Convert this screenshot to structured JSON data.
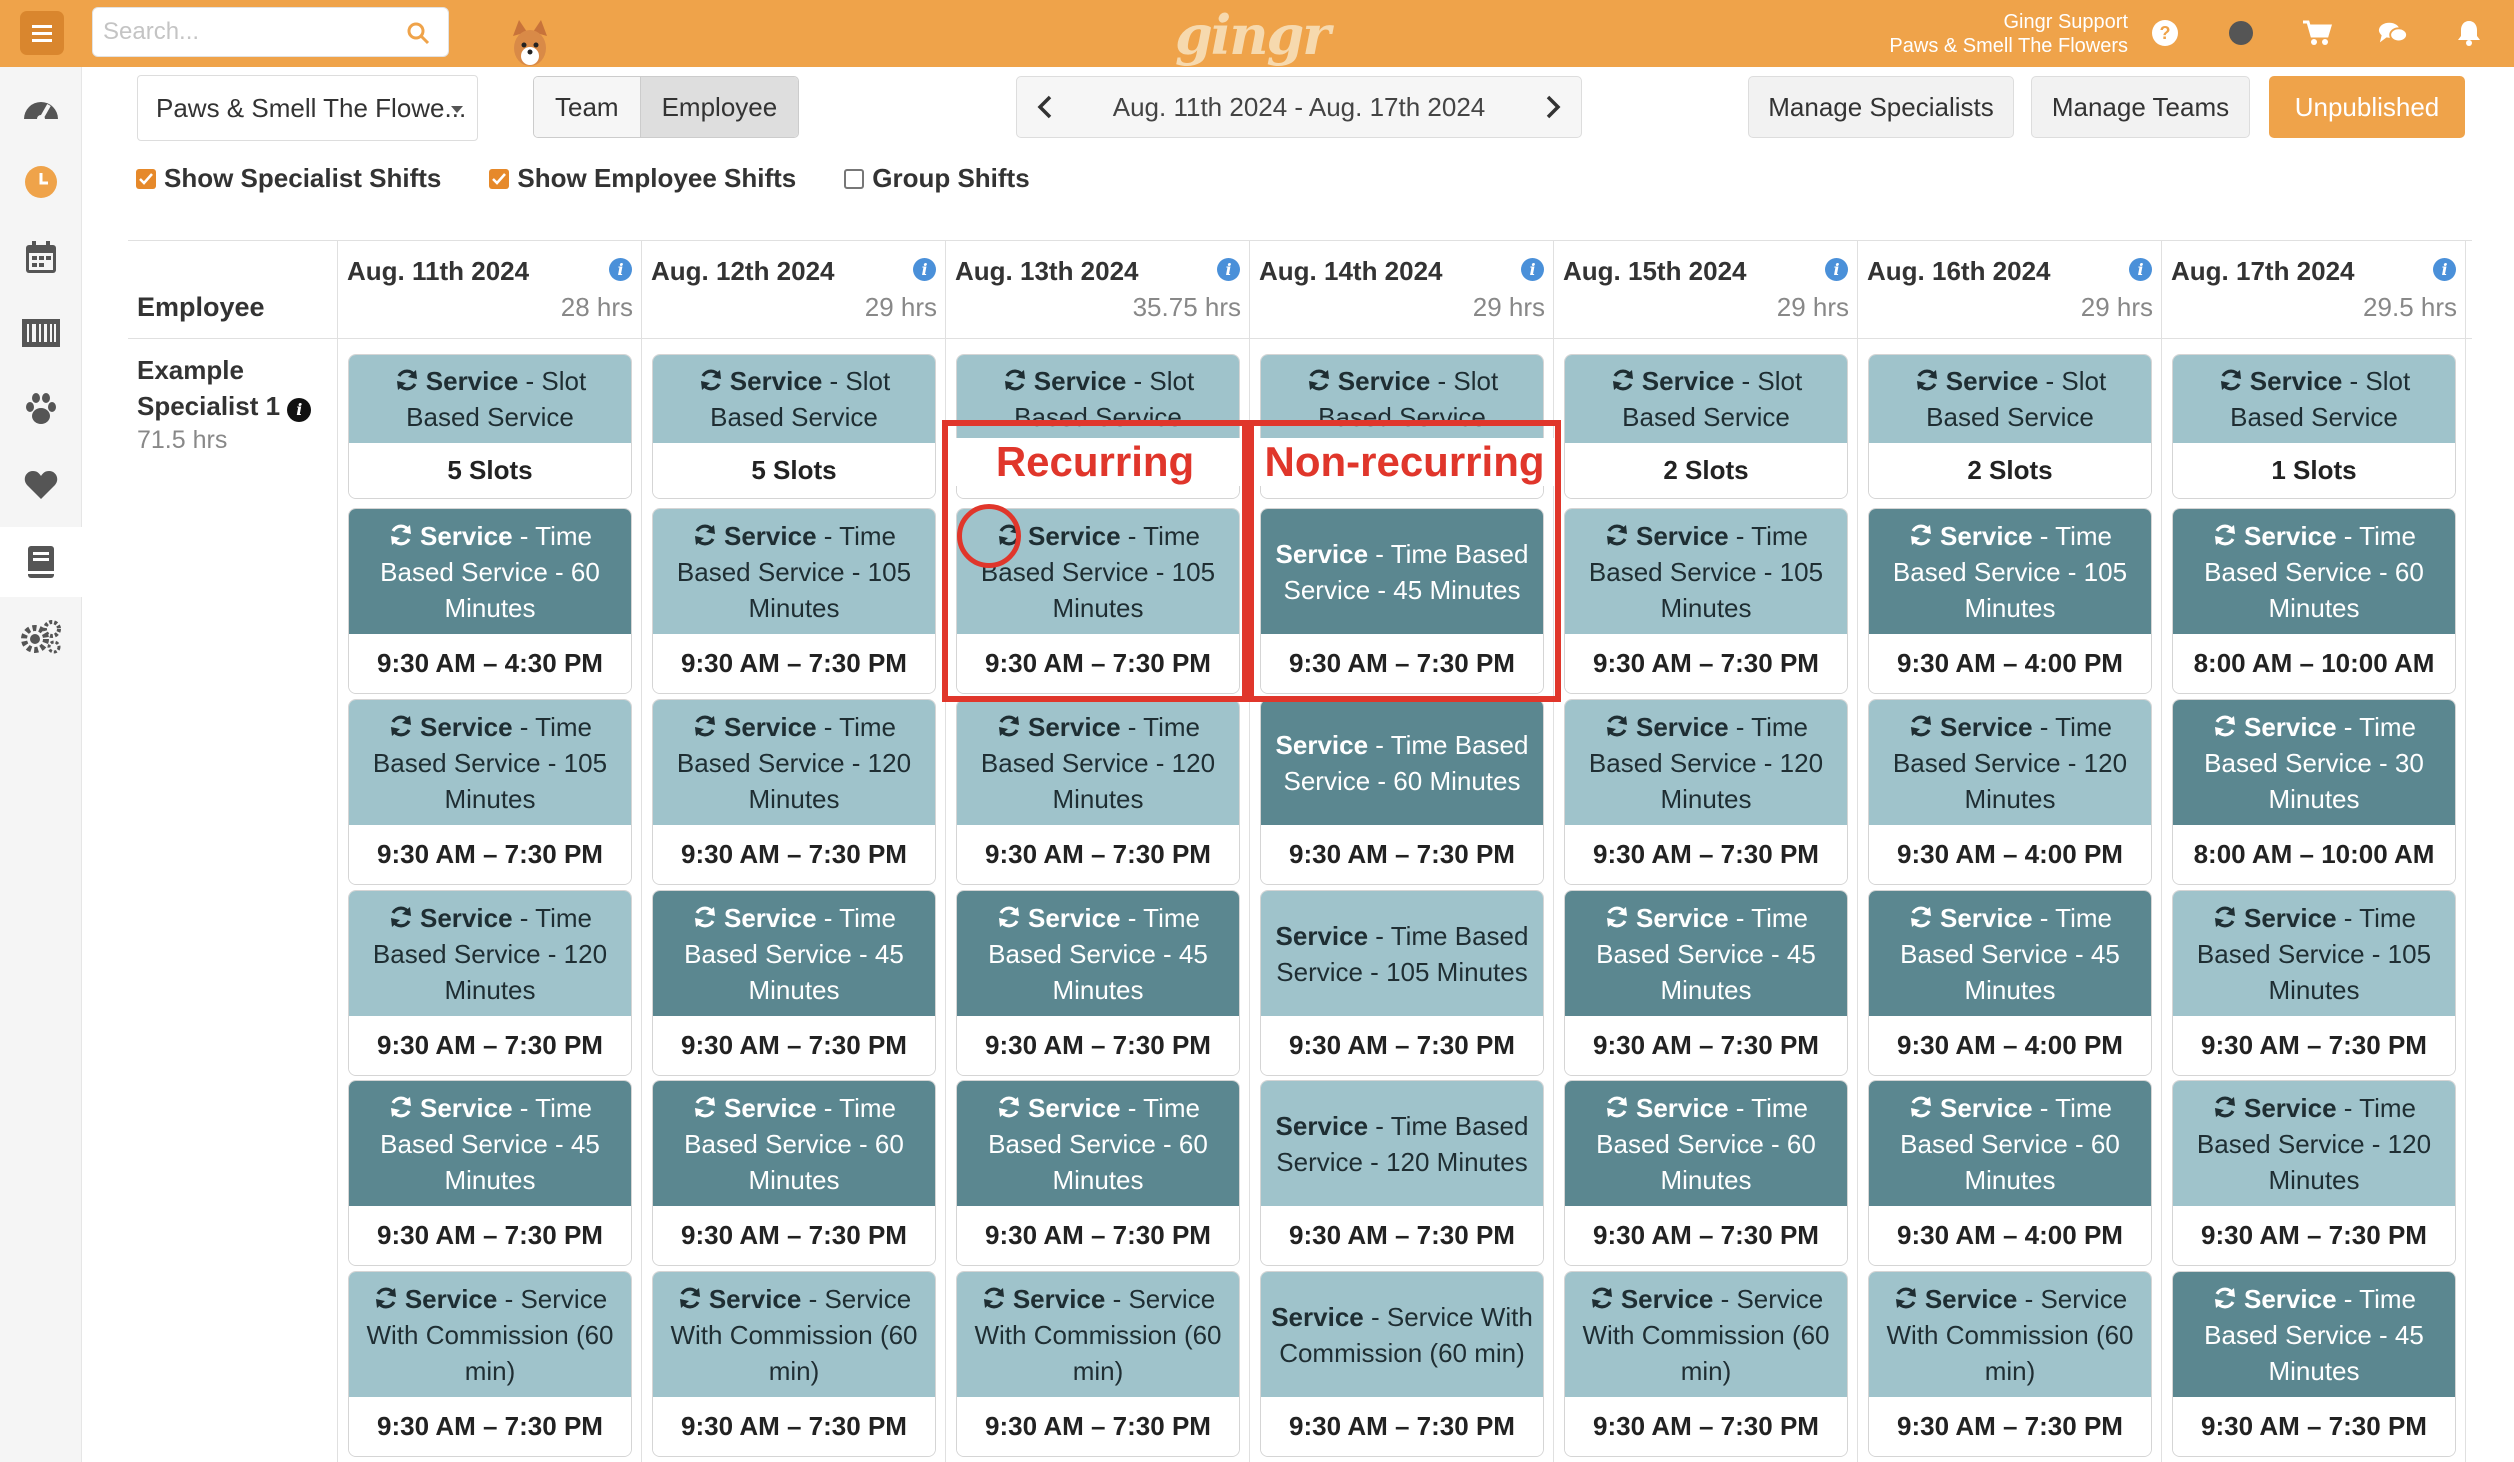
{
  "topbar": {
    "search_placeholder": "Search...",
    "logo": "gingr",
    "support_line1": "Gingr Support",
    "support_line2": "Paws & Smell The Flowers",
    "icons": [
      "help-icon",
      "status-dot-icon",
      "cart-icon",
      "chat-icon",
      "bell-icon"
    ]
  },
  "sidebar": {
    "items": [
      "dashboard-icon",
      "clock-icon",
      "calendar-icon",
      "barcode-icon",
      "paw-icon",
      "heart-icon",
      "book-icon",
      "settings-icon"
    ],
    "active": "book-icon"
  },
  "toolbar": {
    "location": "Paws & Smell The Flowe...",
    "view_team": "Team",
    "view_employee": "Employee",
    "date_range": "Aug. 11th 2024 - Aug. 17th 2024",
    "manage_specialists": "Manage Specialists",
    "manage_teams": "Manage Teams",
    "unpublished": "Unpublished"
  },
  "filters": {
    "show_specialist": "Show Specialist Shifts",
    "show_employee": "Show Employee Shifts",
    "group_shifts": "Group Shifts"
  },
  "table": {
    "employee_header": "Employee",
    "employee_name_1": "Example",
    "employee_name_2": "Specialist 1",
    "employee_hours": "71.5 hrs",
    "days": [
      {
        "date": "Aug. 11th 2024",
        "hours": "28 hrs"
      },
      {
        "date": "Aug. 12th 2024",
        "hours": "29 hrs"
      },
      {
        "date": "Aug. 13th 2024",
        "hours": "35.75 hrs"
      },
      {
        "date": "Aug. 14th 2024",
        "hours": "29 hrs"
      },
      {
        "date": "Aug. 15th 2024",
        "hours": "29 hrs"
      },
      {
        "date": "Aug. 16th 2024",
        "hours": "29 hrs"
      },
      {
        "date": "Aug. 17th 2024",
        "hours": "29.5 hrs"
      }
    ],
    "service_word": "Service",
    "columns": [
      [
        {
          "sub": "Slot Based Service",
          "time": "5 Slots",
          "dark": false,
          "rec": true
        },
        {
          "sub": "Time Based Service - 60 Minutes",
          "time": "9:30 AM – 4:30 PM",
          "dark": true,
          "rec": true
        },
        {
          "sub": "Time Based Service - 105 Minutes",
          "time": "9:30 AM – 7:30 PM",
          "dark": false,
          "rec": true
        },
        {
          "sub": "Time Based Service - 120 Minutes",
          "time": "9:30 AM – 7:30 PM",
          "dark": false,
          "rec": true
        },
        {
          "sub": "Time Based Service - 45 Minutes",
          "time": "9:30 AM – 7:30 PM",
          "dark": true,
          "rec": true
        },
        {
          "sub": "Service With Commission (60 min)",
          "time": "9:30 AM – 7:30 PM",
          "dark": false,
          "rec": true
        }
      ],
      [
        {
          "sub": "Slot Based Service",
          "time": "5 Slots",
          "dark": false,
          "rec": true
        },
        {
          "sub": "Time Based Service - 105 Minutes",
          "time": "9:30 AM – 7:30 PM",
          "dark": false,
          "rec": true
        },
        {
          "sub": "Time Based Service - 120 Minutes",
          "time": "9:30 AM – 7:30 PM",
          "dark": false,
          "rec": true
        },
        {
          "sub": "Time Based Service - 45 Minutes",
          "time": "9:30 AM – 7:30 PM",
          "dark": true,
          "rec": true
        },
        {
          "sub": "Time Based Service - 60 Minutes",
          "time": "9:30 AM – 7:30 PM",
          "dark": true,
          "rec": true
        },
        {
          "sub": "Service With Commission (60 min)",
          "time": "9:30 AM – 7:30 PM",
          "dark": false,
          "rec": true
        }
      ],
      [
        {
          "sub": "Slot Based Service",
          "time": "",
          "dark": false,
          "rec": true
        },
        {
          "sub": "Time Based Service - 105 Minutes",
          "time": "9:30 AM – 7:30 PM",
          "dark": false,
          "rec": true
        },
        {
          "sub": "Time Based Service - 120 Minutes",
          "time": "9:30 AM – 7:30 PM",
          "dark": false,
          "rec": true
        },
        {
          "sub": "Time Based Service - 45 Minutes",
          "time": "9:30 AM – 7:30 PM",
          "dark": true,
          "rec": true
        },
        {
          "sub": "Time Based Service - 60 Minutes",
          "time": "9:30 AM – 7:30 PM",
          "dark": true,
          "rec": true
        },
        {
          "sub": "Service With Commission (60 min)",
          "time": "9:30 AM – 7:30 PM",
          "dark": false,
          "rec": true
        }
      ],
      [
        {
          "sub": "Slot Based Service",
          "time": "",
          "dark": false,
          "rec": true
        },
        {
          "sub": "Time Based Service - 45 Minutes",
          "time": "9:30 AM – 7:30 PM",
          "dark": true,
          "rec": false
        },
        {
          "sub": "Time Based Service - 60 Minutes",
          "time": "9:30 AM – 7:30 PM",
          "dark": true,
          "rec": false
        },
        {
          "sub": "Time Based Service - 105 Minutes",
          "time": "9:30 AM – 7:30 PM",
          "dark": false,
          "rec": false
        },
        {
          "sub": "Time Based Service - 120 Minutes",
          "time": "9:30 AM – 7:30 PM",
          "dark": false,
          "rec": false
        },
        {
          "sub": "Service With Commission (60 min)",
          "time": "9:30 AM – 7:30 PM",
          "dark": false,
          "rec": false
        }
      ],
      [
        {
          "sub": "Slot Based Service",
          "time": "2 Slots",
          "dark": false,
          "rec": true
        },
        {
          "sub": "Time Based Service - 105 Minutes",
          "time": "9:30 AM – 7:30 PM",
          "dark": false,
          "rec": true
        },
        {
          "sub": "Time Based Service - 120 Minutes",
          "time": "9:30 AM – 7:30 PM",
          "dark": false,
          "rec": true
        },
        {
          "sub": "Time Based Service - 45 Minutes",
          "time": "9:30 AM – 7:30 PM",
          "dark": true,
          "rec": true
        },
        {
          "sub": "Time Based Service - 60 Minutes",
          "time": "9:30 AM – 7:30 PM",
          "dark": true,
          "rec": true
        },
        {
          "sub": "Service With Commission (60 min)",
          "time": "9:30 AM – 7:30 PM",
          "dark": false,
          "rec": true
        }
      ],
      [
        {
          "sub": "Slot Based Service",
          "time": "2 Slots",
          "dark": false,
          "rec": true
        },
        {
          "sub": "Time Based Service - 105 Minutes",
          "time": "9:30 AM – 4:00 PM",
          "dark": true,
          "rec": true
        },
        {
          "sub": "Time Based Service - 120 Minutes",
          "time": "9:30 AM – 4:00 PM",
          "dark": false,
          "rec": true
        },
        {
          "sub": "Time Based Service - 45 Minutes",
          "time": "9:30 AM – 4:00 PM",
          "dark": true,
          "rec": true
        },
        {
          "sub": "Time Based Service - 60 Minutes",
          "time": "9:30 AM – 4:00 PM",
          "dark": true,
          "rec": true
        },
        {
          "sub": "Service With Commission (60 min)",
          "time": "9:30 AM – 7:30 PM",
          "dark": false,
          "rec": true
        }
      ],
      [
        {
          "sub": "Slot Based Service",
          "time": "1 Slots",
          "dark": false,
          "rec": true
        },
        {
          "sub": "Time Based Service - 60 Minutes",
          "time": "8:00 AM – 10:00 AM",
          "dark": true,
          "rec": true
        },
        {
          "sub": "Time Based Service - 30 Minutes",
          "time": "8:00 AM – 10:00 AM",
          "dark": true,
          "rec": true
        },
        {
          "sub": "Time Based Service - 105 Minutes",
          "time": "9:30 AM – 7:30 PM",
          "dark": false,
          "rec": true
        },
        {
          "sub": "Time Based Service - 120 Minutes",
          "time": "9:30 AM – 7:30 PM",
          "dark": false,
          "rec": true
        },
        {
          "sub": "Time Based Service - 45 Minutes",
          "time": "9:30 AM – 7:30 PM",
          "dark": true,
          "rec": true
        }
      ]
    ]
  },
  "annotations": {
    "recurring": "Recurring",
    "non_recurring": "Non-recurring"
  },
  "colors": {
    "brand_orange": "#efa34a",
    "card_light": "#9fc3cb",
    "card_dark": "#5b8790",
    "annotation_red": "#e0362b"
  }
}
